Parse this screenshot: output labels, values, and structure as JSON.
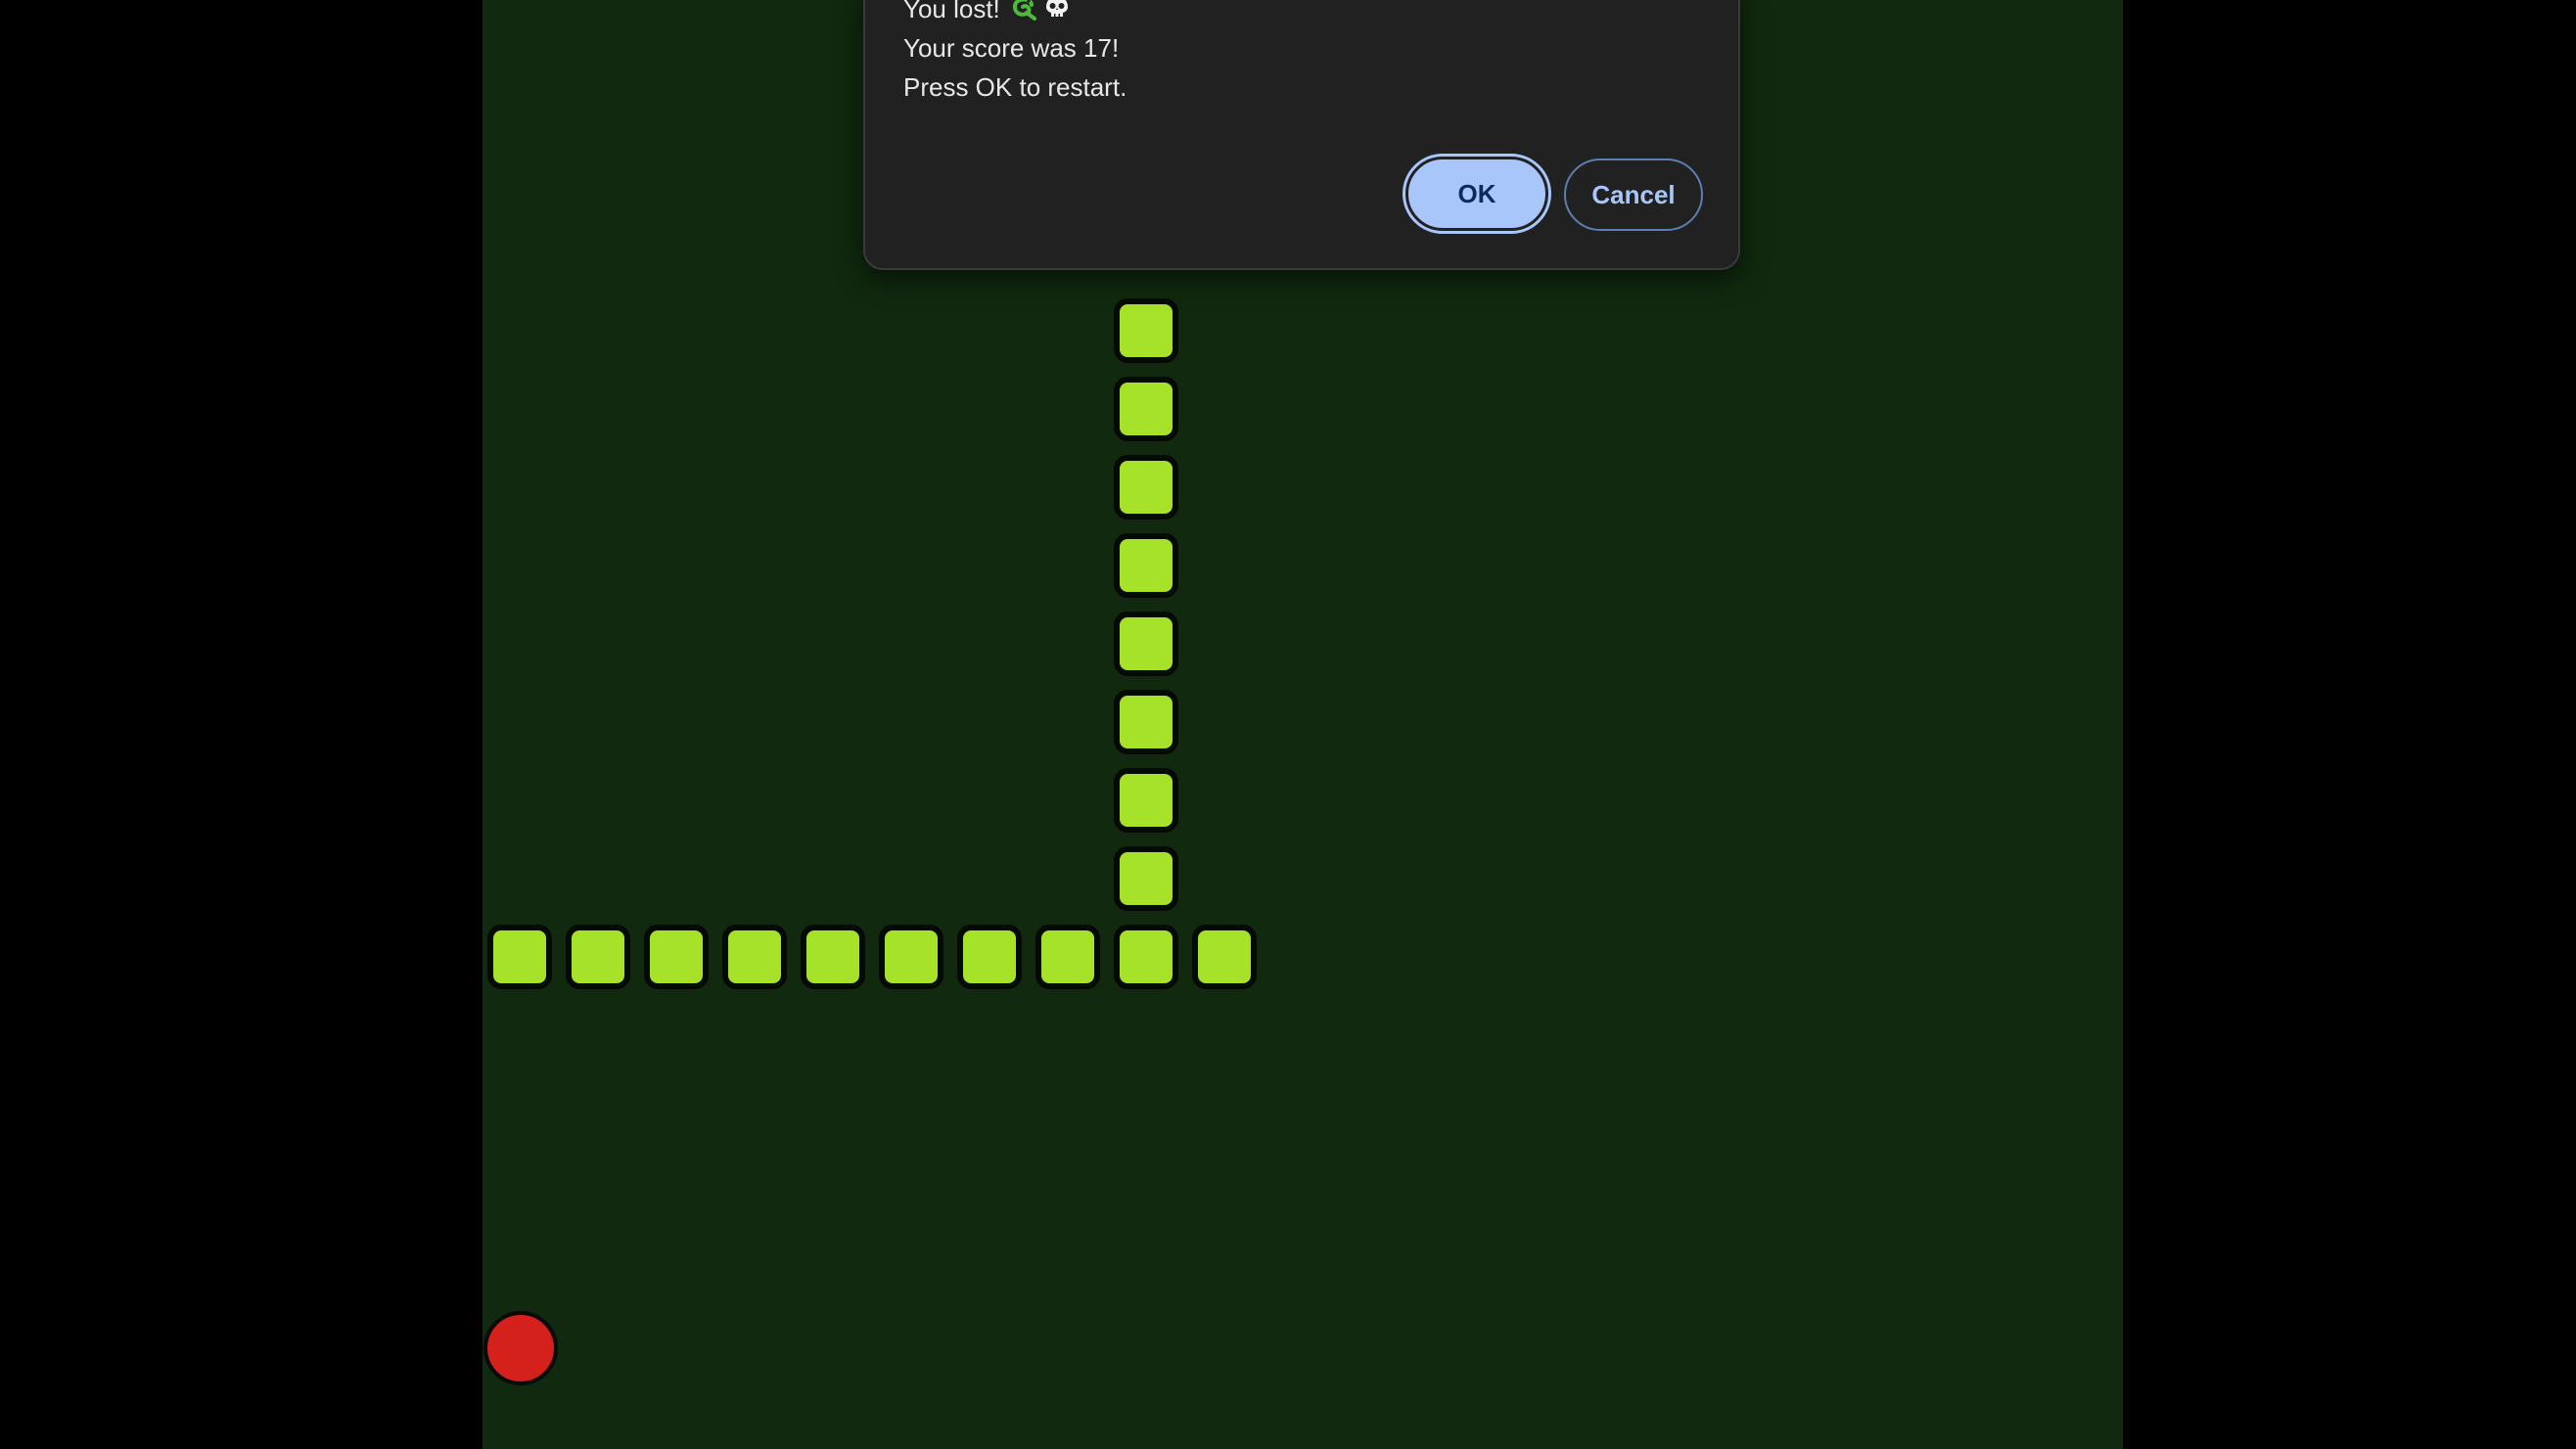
{
  "dialog": {
    "line1": "You lost!",
    "line1_icons": [
      "snake-icon",
      "skull-icon"
    ],
    "line2": "Your score was 17!",
    "line3": "Press OK to restart.",
    "ok_label": "OK",
    "cancel_label": "Cancel"
  },
  "game": {
    "score": 17,
    "snake_segment_count": 18,
    "colors": {
      "board": "#11290e",
      "snake": "#a6e22a",
      "snake_outline": "#060a04",
      "food": "#d5211c",
      "dialog_bg": "#212121",
      "ok_button": "#a8c6fa",
      "cancel_text": "#a8c6fa"
    }
  }
}
